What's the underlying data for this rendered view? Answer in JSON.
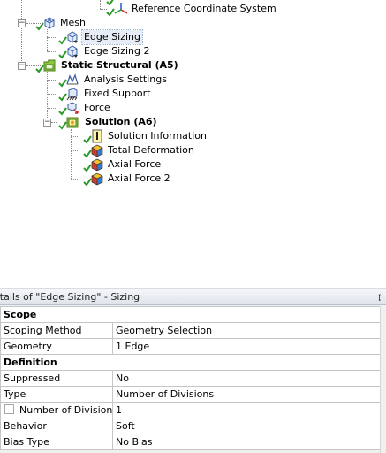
{
  "tree": {
    "items": [
      {
        "key": "refcoord",
        "label": "Reference Coordinate System",
        "bold": false
      },
      {
        "key": "mesh",
        "label": "Mesh",
        "bold": false
      },
      {
        "key": "edgesizing",
        "label": "Edge Sizing",
        "bold": false
      },
      {
        "key": "edgesizing2",
        "label": "Edge Sizing 2",
        "bold": false
      },
      {
        "key": "static",
        "label": "Static Structural (A5)",
        "bold": true
      },
      {
        "key": "analysis",
        "label": "Analysis Settings",
        "bold": false
      },
      {
        "key": "fixed",
        "label": "Fixed Support",
        "bold": false
      },
      {
        "key": "force",
        "label": "Force",
        "bold": false
      },
      {
        "key": "solution",
        "label": "Solution (A6)",
        "bold": true
      },
      {
        "key": "solinfo",
        "label": "Solution Information",
        "bold": false
      },
      {
        "key": "totaldef",
        "label": "Total Deformation",
        "bold": false
      },
      {
        "key": "axial",
        "label": "Axial Force",
        "bold": false
      },
      {
        "key": "axial2",
        "label": "Axial Force 2",
        "bold": false
      }
    ],
    "expand_minus": "−",
    "selected": "edgesizing"
  },
  "details": {
    "title": "etails of \"Edge Sizing\" - Sizing",
    "pin_glyph": "ᵽ",
    "rows": [
      {
        "section": true,
        "name": "Scope",
        "value": ""
      },
      {
        "name": "Scoping Method",
        "value": "Geometry Selection"
      },
      {
        "name": "Geometry",
        "value": "1 Edge"
      },
      {
        "section": true,
        "name": "Definition",
        "value": ""
      },
      {
        "name": "Suppressed",
        "value": "No"
      },
      {
        "name": "Type",
        "value": "Number of Divisions"
      },
      {
        "name": "Number of Divisions",
        "value": "1",
        "checkbox": true
      },
      {
        "name": "Behavior",
        "value": "Soft"
      },
      {
        "name": "Bias Type",
        "value": "No Bias"
      }
    ]
  },
  "colors": {
    "check": "#2a9a2a",
    "mesh_blue": "#3a5fa8",
    "folder_green": "#8cc63f",
    "selection": "#e6edf6"
  },
  "icons": {
    "mesh": "mesh-icon",
    "sizing": "edge-sizing-icon",
    "static": "static-structural-icon",
    "analysis": "analysis-settings-icon",
    "fixed": "fixed-support-icon",
    "force": "force-icon",
    "solution": "solution-icon",
    "solinfo": "solution-information-icon",
    "result": "result-icon",
    "coord": "coordinate-system-icon",
    "check": "check-icon"
  }
}
